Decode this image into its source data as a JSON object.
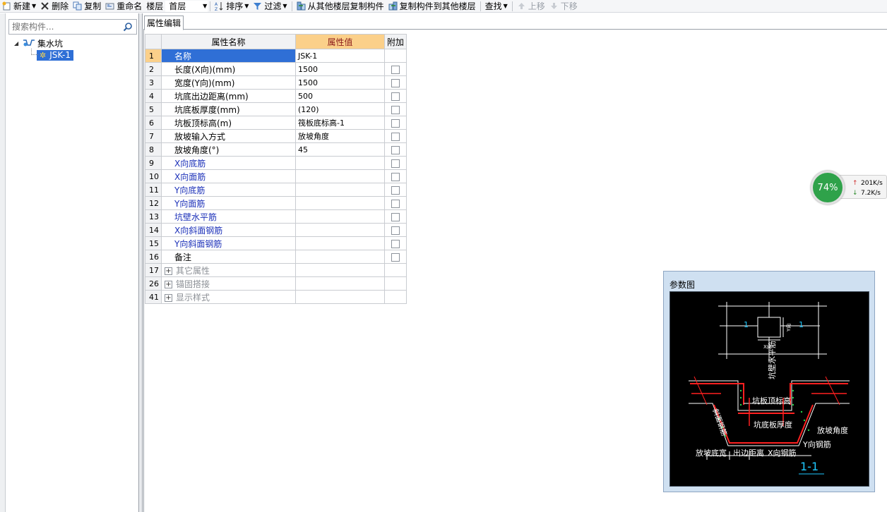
{
  "toolbar": {
    "new_label": "新建",
    "delete_label": "删除",
    "copy_label": "复制",
    "rename_label": "重命名",
    "floor_label": "楼层",
    "floor_value": "首层",
    "sort_label": "排序",
    "filter_label": "过滤",
    "copy_from_floor_label": "从其他楼层复制构件",
    "copy_to_floor_label": "复制构件到其他楼层",
    "find_label": "查找",
    "move_up_label": "上移",
    "move_down_label": "下移"
  },
  "left_panel": {
    "search_placeholder": "搜索构件...",
    "tree_root": "集水坑",
    "tree_child": "JSK-1"
  },
  "prop_editor": {
    "tab_label": "属性编辑",
    "col_name": "属性名称",
    "col_value": "属性值",
    "col_extra": "附加",
    "rows": [
      {
        "num": "1",
        "name": "名称",
        "value": "JSK-1"
      },
      {
        "num": "2",
        "name": "长度(X向)(mm)",
        "value": "1500"
      },
      {
        "num": "3",
        "name": "宽度(Y向)(mm)",
        "value": "1500"
      },
      {
        "num": "4",
        "name": "坑底出边距离(mm)",
        "value": "500"
      },
      {
        "num": "5",
        "name": "坑底板厚度(mm)",
        "value": "(120)"
      },
      {
        "num": "6",
        "name": "坑板顶标高(m)",
        "value": "筏板底标高-1"
      },
      {
        "num": "7",
        "name": "放坡输入方式",
        "value": "放坡角度"
      },
      {
        "num": "8",
        "name": "放坡角度(°)",
        "value": "45"
      },
      {
        "num": "9",
        "name": "X向底筋",
        "value": ""
      },
      {
        "num": "10",
        "name": "X向面筋",
        "value": ""
      },
      {
        "num": "11",
        "name": "Y向底筋",
        "value": ""
      },
      {
        "num": "12",
        "name": "Y向面筋",
        "value": ""
      },
      {
        "num": "13",
        "name": "坑壁水平筋",
        "value": ""
      },
      {
        "num": "14",
        "name": "X向斜面钢筋",
        "value": ""
      },
      {
        "num": "15",
        "name": "Y向斜面钢筋",
        "value": ""
      },
      {
        "num": "16",
        "name": "备注",
        "value": ""
      },
      {
        "num": "17",
        "name": "其它属性",
        "value": ""
      },
      {
        "num": "26",
        "name": "锚固搭接",
        "value": ""
      },
      {
        "num": "41",
        "name": "显示样式",
        "value": ""
      }
    ]
  },
  "net_widget": {
    "percent": "74%",
    "upload": "201K/s",
    "download": "7.2K/s"
  },
  "param_panel": {
    "title": "参数图",
    "labels": {
      "sec_left": "1",
      "sec_right": "1",
      "x_dir": "X向",
      "y_dir": "Y向",
      "wall_horizontal": "坑壁水平筋",
      "top_elev": "坑板顶标高",
      "slope_rebar": "斜面钢筋",
      "bottom_thick": "坑底板厚度",
      "slope_angle": "放坡角度",
      "y_rebar": "Y向钢筋",
      "slope_bottom_width": "放坡底宽",
      "edge_dist": "出边距离",
      "x_rebar": "X向钢筋",
      "section": "1-1"
    }
  },
  "colors": {
    "selection": "#2f6fd6",
    "header_highlight": "#fbd08a",
    "blue_text": "#1a2fb8",
    "rebar_red": "#ff2020",
    "section_cyan": "#1ec8ff"
  }
}
